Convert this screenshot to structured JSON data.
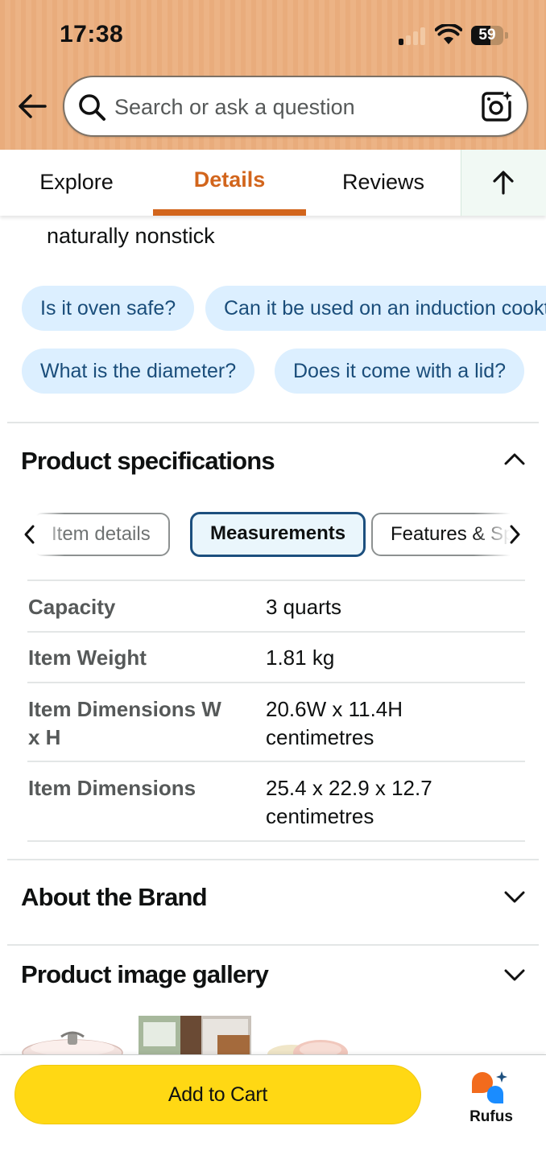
{
  "status_bar": {
    "time": "17:38",
    "battery_level": "59",
    "battery_fraction": 0.59,
    "signal_bars_active": 1
  },
  "header": {
    "search_placeholder": "Search or ask a question",
    "accent": "#e9ac7c"
  },
  "tabs": {
    "items": [
      {
        "label": "Explore"
      },
      {
        "label": "Details"
      },
      {
        "label": "Reviews"
      }
    ],
    "active_color": "#d2651c"
  },
  "description_tail": "naturally nonstick",
  "suggested_questions": [
    "Is it oven safe?",
    "Can it be used on an induction cooktop?",
    "What is the diameter?",
    "Does it come with a lid?"
  ],
  "specifications": {
    "title": "Product specifications",
    "subtabs": [
      "Item details",
      "Measurements",
      "Features & Specs"
    ],
    "active_subtab": "Measurements",
    "rows": [
      {
        "label": "Capacity",
        "value": "3 quarts"
      },
      {
        "label": "Item Weight",
        "value": "1.81 kg"
      },
      {
        "label": "Item Dimensions W x H",
        "value": "20.6W x 11.4H centimetres"
      },
      {
        "label": "Item Dimensions",
        "value": "25.4 x 22.9 x 12.7 centimetres"
      }
    ]
  },
  "about_brand": {
    "title": "About the Brand"
  },
  "gallery": {
    "title": "Product image gallery"
  },
  "bottom_bar": {
    "add_to_cart": "Add to Cart",
    "rufus_label": "Rufus",
    "button_color": "#ffd814"
  }
}
